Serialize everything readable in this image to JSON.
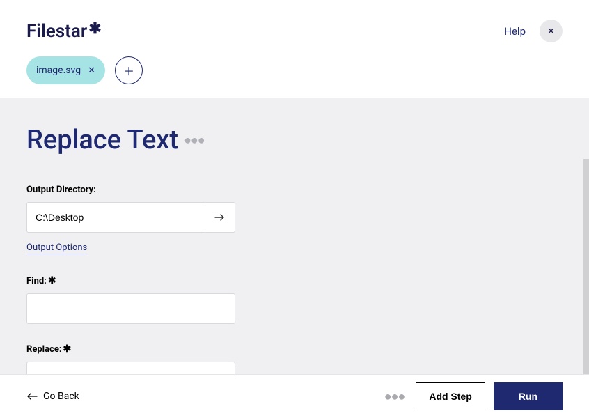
{
  "brand": {
    "name": "Filestar"
  },
  "header": {
    "help_label": "Help",
    "file_chip": "image.svg"
  },
  "main": {
    "title": "Replace Text",
    "output_directory_label": "Output Directory:",
    "output_directory_value": "C:\\Desktop",
    "output_options_label": "Output Options",
    "find_label": "Find:",
    "find_value": "",
    "replace_label": "Replace:",
    "replace_value": ""
  },
  "footer": {
    "go_back_label": "Go Back",
    "add_step_label": "Add Step",
    "run_label": "Run"
  }
}
